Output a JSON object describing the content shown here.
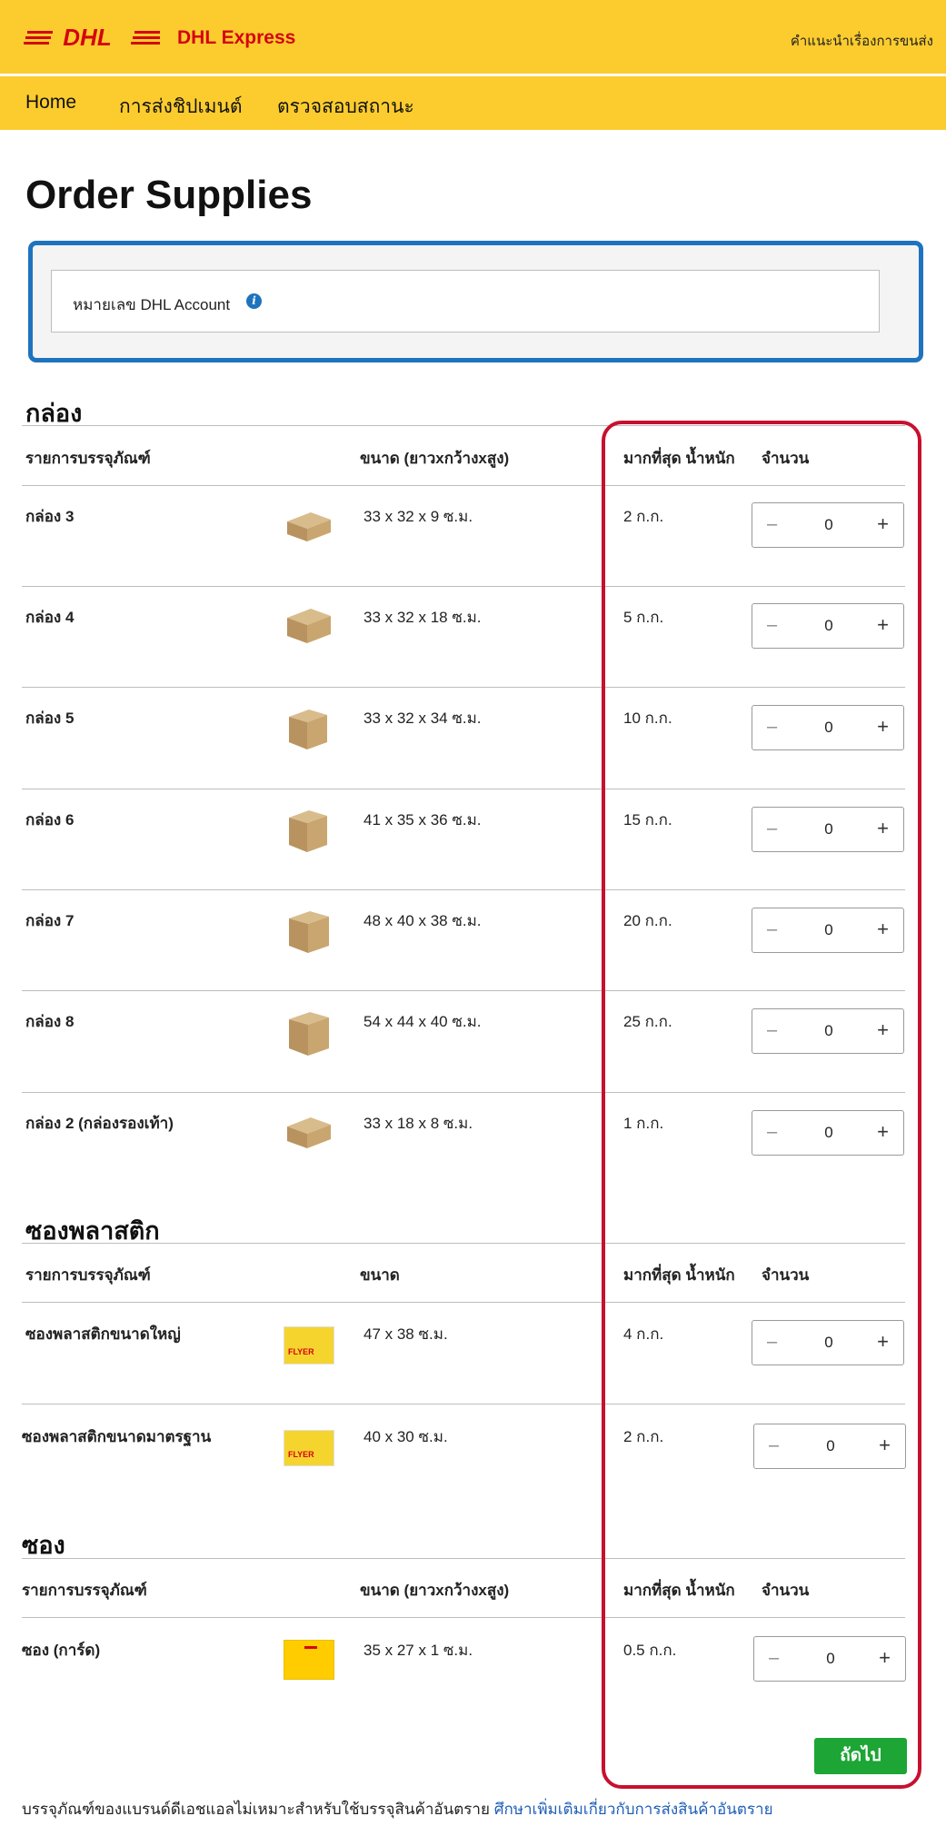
{
  "header": {
    "logo_text": "DHL",
    "brand": "DHL Express",
    "help_link": "คำแนะนำเรื่องการขนส่ง",
    "brand_color": "#FCCC2E",
    "logo_red": "#D40511"
  },
  "nav": {
    "items": [
      {
        "label": "Home"
      },
      {
        "label": "การส่งชิปเมนต์"
      },
      {
        "label": "ตรวจสอบสถานะ"
      }
    ]
  },
  "page": {
    "title": "Order Supplies",
    "account_label": "หมายเลข DHL Account",
    "info_icon": "info-icon"
  },
  "sections": {
    "boxes": {
      "title": "กล่อง",
      "headers": [
        "รายการบรรจุภัณฑ์",
        "ขนาด (ยาวxกว้างxสูง)",
        "มากที่สุด น้ำหนัก",
        "จำนวน"
      ],
      "items": [
        {
          "name": "กล่อง 3",
          "size": "33 x 32 x 9 ซ.ม.",
          "weight": "2 ก.ก.",
          "qty": "0"
        },
        {
          "name": "กล่อง 4",
          "size": "33 x 32 x 18 ซ.ม.",
          "weight": "5 ก.ก.",
          "qty": "0"
        },
        {
          "name": "กล่อง 5",
          "size": "33 x 32 x 34 ซ.ม.",
          "weight": "10 ก.ก.",
          "qty": "0"
        },
        {
          "name": "กล่อง 6",
          "size": "41 x 35 x 36 ซ.ม.",
          "weight": "15 ก.ก.",
          "qty": "0"
        },
        {
          "name": "กล่อง 7",
          "size": "48 x 40 x 38 ซ.ม.",
          "weight": "20 ก.ก.",
          "qty": "0"
        },
        {
          "name": "กล่อง 8",
          "size": "54 x 44 x 40 ซ.ม.",
          "weight": "25 ก.ก.",
          "qty": "0"
        },
        {
          "name": "กล่อง 2 (กล่องรองเท้า)",
          "size": "33 x 18 x 8 ซ.ม.",
          "weight": "1 ก.ก.",
          "qty": "0"
        }
      ]
    },
    "flyers": {
      "title": "ซองพลาสติก",
      "headers": [
        "รายการบรรจุภัณฑ์",
        "ขนาด",
        "มากที่สุด น้ำหนัก",
        "จำนวน"
      ],
      "items": [
        {
          "name": "ซองพลาสติกขนาดใหญ่",
          "size": "47 x 38 ซ.ม.",
          "weight": "4 ก.ก.",
          "qty": "0",
          "thumb_text": "FLYER"
        },
        {
          "name": "ซองพลาสติกขนาดมาตรฐาน",
          "size": "40 x 30 ซ.ม.",
          "weight": "2 ก.ก.",
          "qty": "0",
          "thumb_text": "FLYER"
        }
      ]
    },
    "envelopes": {
      "title": "ซอง",
      "headers": [
        "รายการบรรจุภัณฑ์",
        "ขนาด (ยาวxกว้างxสูง)",
        "มากที่สุด น้ำหนัก",
        "จำนวน"
      ],
      "items": [
        {
          "name": "ซอง (การ์ด)",
          "size": "35 x 27 x 1 ซ.ม.",
          "weight": "0.5 ก.ก.",
          "qty": "0"
        }
      ]
    }
  },
  "stepper": {
    "minus": "–",
    "plus": "+"
  },
  "actions": {
    "next_label": "ถัดไป",
    "next_color": "#1DA535"
  },
  "footer": {
    "note": "บรรจุภัณฑ์ของแบรนด์ดีเอชแอลไม่เหมาะสำหรับใช้บรรจุสินค้าอันตราย",
    "link": "ศึกษาเพิ่มเติมเกี่ยวกับการส่งสินค้าอันตราย"
  },
  "annotations": {
    "account_box_color": "#1E73BE",
    "quantity_box_color": "#C8102E"
  }
}
